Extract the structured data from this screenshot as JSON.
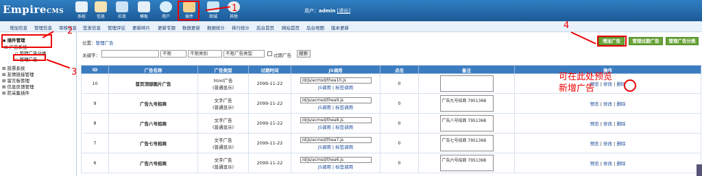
{
  "header": {
    "logo_main": "Empire",
    "logo_sub": "CMS",
    "nav": [
      {
        "label": "系统",
        "color": "#e9f1f9"
      },
      {
        "label": "信息",
        "color": "#f4e2b2"
      },
      {
        "label": "栏目",
        "color": "#cfe3f7"
      },
      {
        "label": "模板",
        "color": "#e6eef8"
      },
      {
        "label": "用户",
        "color": "#d9eefb"
      },
      {
        "label": "插件",
        "color": "#f7d28a"
      },
      {
        "label": "商城",
        "color": "#cbe7f5"
      },
      {
        "label": "其他",
        "color": "#e8e8e8"
      }
    ],
    "user_prefix": "用户：",
    "username": "admin",
    "logout": "[退出]"
  },
  "subnav": [
    "增加信息",
    "管理信息",
    "审核信息",
    "签发信息",
    "管理评论",
    "更新碎片",
    "更新专题",
    "数据更新",
    "数据统计",
    "排行统计",
    "后台首页",
    "网站首页",
    "后台地图",
    "版本更新"
  ],
  "sidebar": {
    "items": [
      {
        "label": "插件管理"
      },
      {
        "label": "广告系统"
      },
      {
        "label": "管理广告分类"
      },
      {
        "label": "管理广告"
      },
      {
        "label": "投票系统"
      },
      {
        "label": "友情链接管理"
      },
      {
        "label": "留言板管理"
      },
      {
        "label": "信息反馈管理"
      },
      {
        "label": "防采集插件"
      }
    ]
  },
  "main": {
    "location_prefix": "位置：",
    "location": "管理广告",
    "buttons": [
      "增加广告",
      "管理过期广告",
      "管理广告分类"
    ],
    "search": {
      "keyword_label": "关键字：",
      "select1": "不限",
      "select2": "不限类别",
      "select3": "不限广告类型",
      "expired_label": "过期广告",
      "search_button": "搜索"
    },
    "columns": [
      "ID",
      "广告名称",
      "广告类型",
      "过期时间",
      "JS调用",
      "点击",
      "备注",
      "操作"
    ],
    "rows": [
      {
        "id": "10",
        "name": "首页顶部图片广告",
        "type1": "html广告",
        "type2": "(普通显示)",
        "expire": "2099-11-22",
        "js": "/d/js/acmsd/thea10.js",
        "js_links": "JS调用 | 标签调用",
        "clicks": "0",
        "note": "",
        "ops": [
          "预览",
          "修改",
          "删除"
        ]
      },
      {
        "id": "9",
        "name": "广告九号招商",
        "type1": "文字广告",
        "type2": "(普通显示)",
        "expire": "2099-11-22",
        "js": "/d/js/acmsd/thea9.js",
        "js_links": "JS调用 | 标签调用",
        "clicks": "0",
        "note": "广告九号招商 7951368",
        "ops": [
          "预览",
          "修改",
          "删除"
        ]
      },
      {
        "id": "8",
        "name": "广告八号招商",
        "type1": "文字广告",
        "type2": "(普通显示)",
        "expire": "2099-11-22",
        "js": "/d/js/acmsd/thea8.js",
        "js_links": "JS调用 | 标签调用",
        "clicks": "0",
        "note": "广告八号招商 7951368",
        "ops": [
          "预览",
          "修改",
          "删除"
        ]
      },
      {
        "id": "7",
        "name": "广告七号招商",
        "type1": "文字广告",
        "type2": "(普通显示)",
        "expire": "2099-11-22",
        "js": "/d/js/acmsd/thea7.js",
        "js_links": "JS调用 | 标签调用",
        "clicks": "0",
        "note": "广告七号招商 7951368",
        "ops": [
          "预览",
          "修改",
          "删除"
        ]
      },
      {
        "id": "6",
        "name": "广告六号招商",
        "type1": "文字广告",
        "type2": "(普通显示)",
        "expire": "2099-11-22",
        "js": "/d/js/acmsd/thea6.js",
        "js_links": "JS调用 | 标签调用",
        "clicks": "0",
        "note": "广告六号招商 7951368",
        "ops": [
          "预览",
          "修改",
          "删除"
        ]
      }
    ]
  },
  "annotations": {
    "n1": "1",
    "n2": "2",
    "n3": "3",
    "n4": "4",
    "note": "可在此处预览新增广告"
  }
}
